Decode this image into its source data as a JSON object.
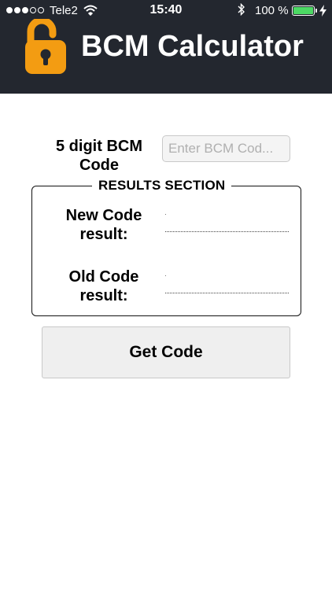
{
  "status_bar": {
    "carrier": "Tele2",
    "time": "15:40",
    "battery_percent": "100 %",
    "battery_level": 1.0,
    "signal_bars_filled": 3,
    "signal_bars_total": 5,
    "icons": [
      "wifi-icon",
      "bluetooth-icon",
      "battery-icon",
      "charging-bolt-icon"
    ]
  },
  "header": {
    "title": "BCM Calculator",
    "logo_icon": "unlocked-padlock-icon",
    "logo_color": "#f39c12",
    "background_color": "#23272f"
  },
  "form": {
    "bcm_label": "5 digit BCM Code",
    "bcm_input_value": "",
    "bcm_input_placeholder": "Enter BCM Cod..."
  },
  "results": {
    "section_title": "RESULTS SECTION",
    "new_code_label": "New Code result:",
    "new_code_value": "",
    "old_code_label": "Old Code result:",
    "old_code_value": ""
  },
  "actions": {
    "get_code_label": "Get Code"
  }
}
